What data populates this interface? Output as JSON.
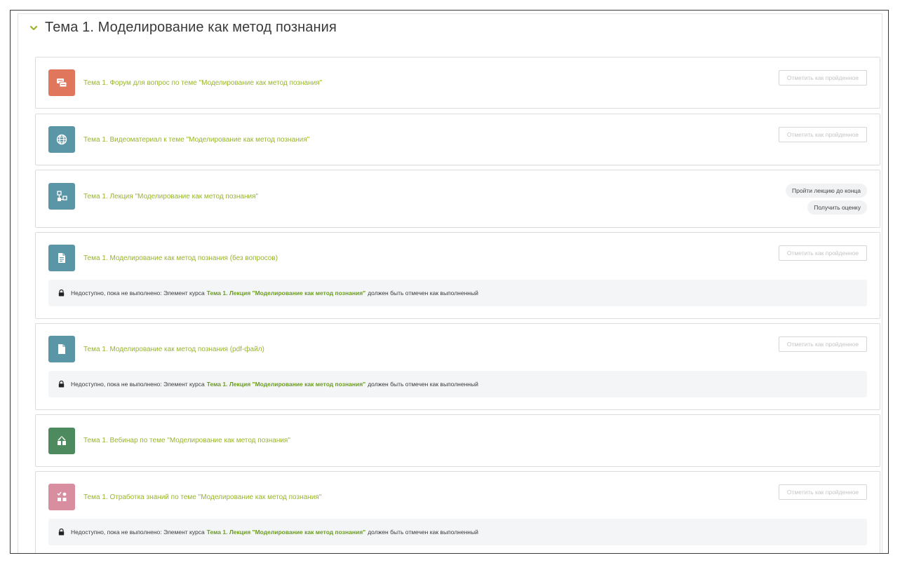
{
  "section": {
    "title": "Тема 1. Моделирование как метод познания"
  },
  "colors": {
    "accent_link": "#98b52b",
    "forum_icon_bg": "#e0775c",
    "teal_icon_bg": "#5b96a6",
    "webinar_icon_bg": "#4d8a5e",
    "quiz_icon_bg": "#d88e9e"
  },
  "activities": [
    {
      "icon": "forum-icon",
      "title": "Тема 1. Форум для вопрос по теме \"Моделирование как метод познания\"",
      "complete_label": "Отметить как пройденное"
    },
    {
      "icon": "globe-icon",
      "title": "Тема 1. Видеоматериал к теме \"Моделирование как метод познания\"",
      "complete_label": "Отметить как пройденное"
    },
    {
      "icon": "lesson-icon",
      "title": "Тема 1. Лекция \"Моделирование как метод познания\"",
      "pill_1": "Пройти лекцию до конца",
      "pill_2": "Получить оценку"
    },
    {
      "icon": "page-icon",
      "title": "Тема 1. Моделирование как метод познания (без вопросов)",
      "complete_label": "Отметить как пройденное",
      "restriction": {
        "prefix": "Недоступно, пока не выполнено: Элемент курса",
        "strong": "Тема 1. Лекция \"Моделирование как метод познания\"",
        "suffix": "должен быть отмечен как выполненный"
      }
    },
    {
      "icon": "file-icon",
      "title": "Тема 1. Моделирование как метод познания (pdf-файл)",
      "complete_label": "Отметить как пройденное",
      "restriction": {
        "prefix": "Недоступно, пока не выполнено: Элемент курса",
        "strong": "Тема 1. Лекция \"Моделирование как метод познания\"",
        "suffix": "должен быть отмечен как выполненный"
      }
    },
    {
      "icon": "webinar-icon",
      "title": "Тема 1. Вебинар по теме \"Моделирование как метод познания\""
    },
    {
      "icon": "quiz-icon",
      "title": "Тема 1. Отработка знаний по теме \"Моделирование как метод познания\"",
      "complete_label": "Отметить как пройденное",
      "restriction": {
        "prefix": "Недоступно, пока не выполнено: Элемент курса",
        "strong": "Тема 1. Лекция \"Моделирование как метод познания\"",
        "suffix": "должен быть отмечен как выполненный"
      }
    }
  ]
}
